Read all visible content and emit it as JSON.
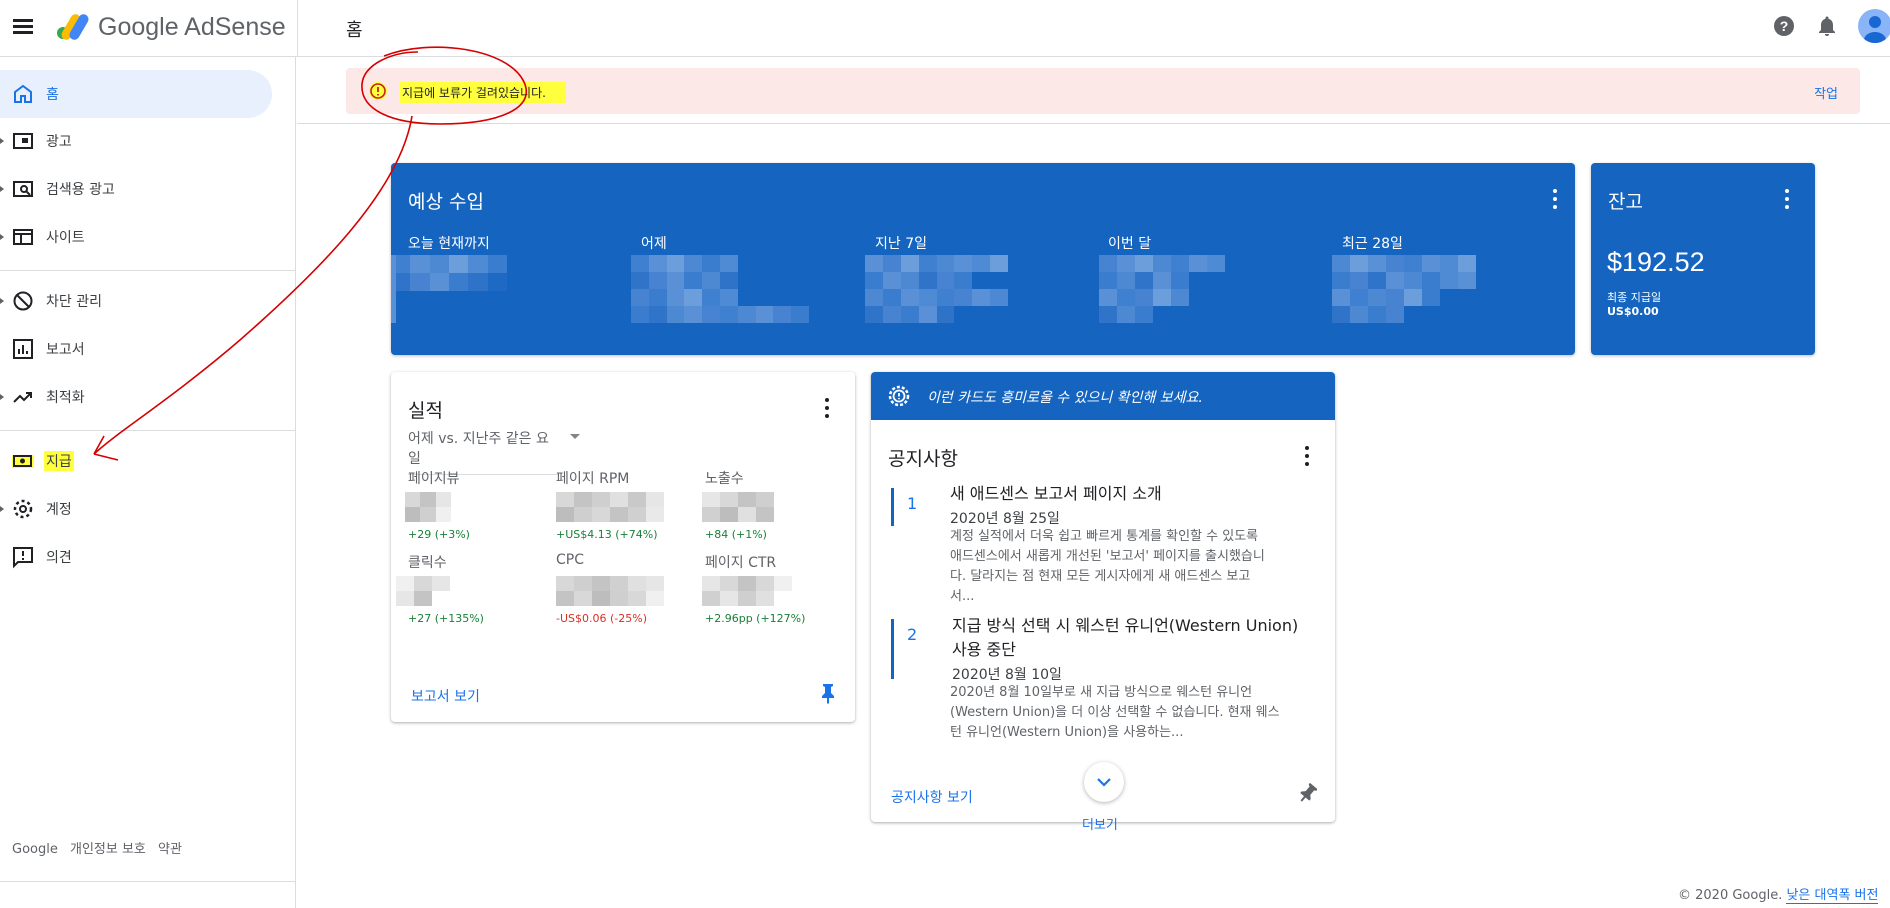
{
  "app": {
    "brand": "Google AdSense",
    "page_title": "홈"
  },
  "sidebar": {
    "items": [
      {
        "label": "홈",
        "icon": "home-icon"
      },
      {
        "label": "광고",
        "icon": "ads-icon"
      },
      {
        "label": "검색용 광고",
        "icon": "search-ads-icon"
      },
      {
        "label": "사이트",
        "icon": "sites-icon"
      },
      {
        "label": "차단 관리",
        "icon": "block-icon"
      },
      {
        "label": "보고서",
        "icon": "bar-chart-icon"
      },
      {
        "label": "최적화",
        "icon": "trending-up-icon"
      },
      {
        "label": "지급",
        "icon": "payments-icon"
      },
      {
        "label": "계정",
        "icon": "gear-icon"
      },
      {
        "label": "의견",
        "icon": "feedback-icon"
      }
    ],
    "footer": [
      "Google",
      "개인정보 보호",
      "약관"
    ]
  },
  "alert": {
    "text": "지급에 보류가 걸려있습니다.",
    "action": "작업"
  },
  "estimated_earnings": {
    "title": "예상 수입",
    "metrics": [
      "오늘 현재까지",
      "어제",
      "지난 7일",
      "이번 달",
      "최근 28일"
    ]
  },
  "balance": {
    "title": "잔고",
    "amount": "$192.52",
    "last_payment_label": "최종 지급일",
    "last_payment_value": "US$0.00"
  },
  "performance": {
    "title": "실적",
    "comparison": "어제 vs. 지난주 같은 요일",
    "metrics": [
      {
        "label": "페이지뷰",
        "delta": "+29 (+3%)",
        "trend": "up"
      },
      {
        "label": "페이지 RPM",
        "delta": "+US$4.13 (+74%)",
        "trend": "up"
      },
      {
        "label": "노출수",
        "delta": "+84 (+1%)",
        "trend": "up"
      },
      {
        "label": "클릭수",
        "delta": "+27 (+135%)",
        "trend": "up"
      },
      {
        "label": "CPC",
        "delta": "-US$0.06 (-25%)",
        "trend": "down"
      },
      {
        "label": "페이지 CTR",
        "delta": "+2.96pp (+127%)",
        "trend": "up"
      }
    ],
    "link": "보고서 보기"
  },
  "tip": {
    "text": "이런 카드도 흥미로울 수 있으니 확인해 보세요."
  },
  "announcements": {
    "title": "공지사항",
    "items": [
      {
        "num": "1",
        "title": "새 애드센스 보고서 페이지 소개",
        "date": "2020년 8월 25일",
        "body": [
          "계정 실적에서 더욱 쉽고 빠르게 통계를 확인할 수 있도록",
          "애드센스에서 새롭게 개선된 '보고서' 페이지를 출시했습니",
          "다. 달라지는 점 현재 모든 게시자에게 새 애드센스 보고",
          "서..."
        ]
      },
      {
        "num": "2",
        "title_lines": [
          "지급 방식 선택 시 웨스턴 유니언(Western Union)",
          "사용 중단"
        ],
        "date": "2020년 8월 10일",
        "body": [
          "2020년 8월 10일부로 새 지급 방식으로 웨스턴 유니언",
          "(Western Union)을 더 이상 선택할 수 없습니다. 현재 웨스",
          "턴 유니언(Western Union)을 사용하는..."
        ]
      }
    ],
    "link": "공지사항 보기",
    "more": "더보기"
  },
  "footer": {
    "copyright": "© 2020 Google.",
    "link": "낮은 대역폭 버전"
  },
  "colors": {
    "card_blue": "#1565c0",
    "link_blue": "#1a73e8",
    "alert_bg": "#fce8e6",
    "highlight": "#ffff3d",
    "annotation_red": "#d50000"
  }
}
